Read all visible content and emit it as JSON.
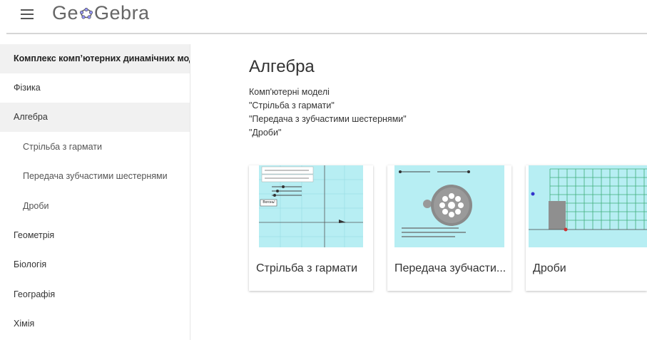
{
  "header": {
    "logo_text": "GeoGebra",
    "menu_icon": "hamburger-icon"
  },
  "sidebar": {
    "items": [
      {
        "label": "Комплекс комп’ютерних динамічних моделей"
      },
      {
        "label": "Фізика"
      },
      {
        "label": "Алгебра"
      },
      {
        "label": "Стрільба з гармати"
      },
      {
        "label": "Передача зубчастими шестернями"
      },
      {
        "label": "Дроби"
      },
      {
        "label": "Геометрія"
      },
      {
        "label": "Біологія"
      },
      {
        "label": "Географія"
      },
      {
        "label": "Хімія"
      }
    ]
  },
  "main": {
    "title": "Алгебра",
    "description": [
      "Комп'ютерні моделі",
      "\"Стрільба з гармати\"",
      "\"Передача з зубчастими шестернями\"",
      "\"Дроби\""
    ],
    "cards": [
      {
        "title": "Стрільба з гармати",
        "thumb_button": "Вогонь!"
      },
      {
        "title": "Передача зубчасти..."
      },
      {
        "title": "Дроби"
      }
    ]
  },
  "colors": {
    "thumb_bg": "#b7eef3",
    "active_item_bg": "#f1f1f1",
    "logo_flower": "#6557d2"
  }
}
